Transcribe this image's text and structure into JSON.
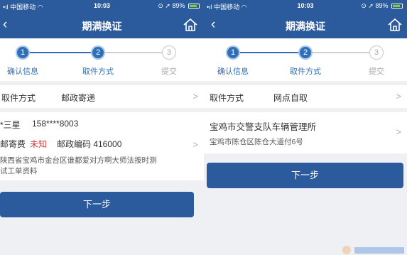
{
  "status_bar": {
    "carrier": "中国移动",
    "time": "10:03",
    "battery": "89%"
  },
  "nav": {
    "title": "期满换证",
    "back_glyph": "‹"
  },
  "steps": {
    "items": [
      {
        "num": "1",
        "label": "确认信息",
        "state": "done"
      },
      {
        "num": "2",
        "label": "取件方式",
        "state": "active"
      },
      {
        "num": "3",
        "label": "提交",
        "state": "todo"
      }
    ]
  },
  "left": {
    "pickup": {
      "label": "取件方式",
      "value": "邮政寄递"
    },
    "address": {
      "name": "*三星",
      "phone": "158****8003",
      "fee_label": "邮寄费",
      "fee_value": "未知",
      "postcode": "邮政编码 416000",
      "line1": "陕西省宝鸡市金台区谁都爱对方啊大师法按时测",
      "line2": "试工单资料"
    },
    "next_label": "下一步"
  },
  "right": {
    "pickup": {
      "label": "取件方式",
      "value": "网点自取"
    },
    "office": {
      "name": "宝鸡市交警支队车辆管理所",
      "address": "宝鸡市陈仓区陈仓大道付6号"
    },
    "next_label": "下一步"
  },
  "colors": {
    "primary": "#2b5b9c",
    "accent": "#2f6fb9",
    "warning": "#e03a3a"
  },
  "icons": [
    "back-icon",
    "home-icon",
    "chevron-right-icon",
    "wifi-icon",
    "battery-icon"
  ]
}
